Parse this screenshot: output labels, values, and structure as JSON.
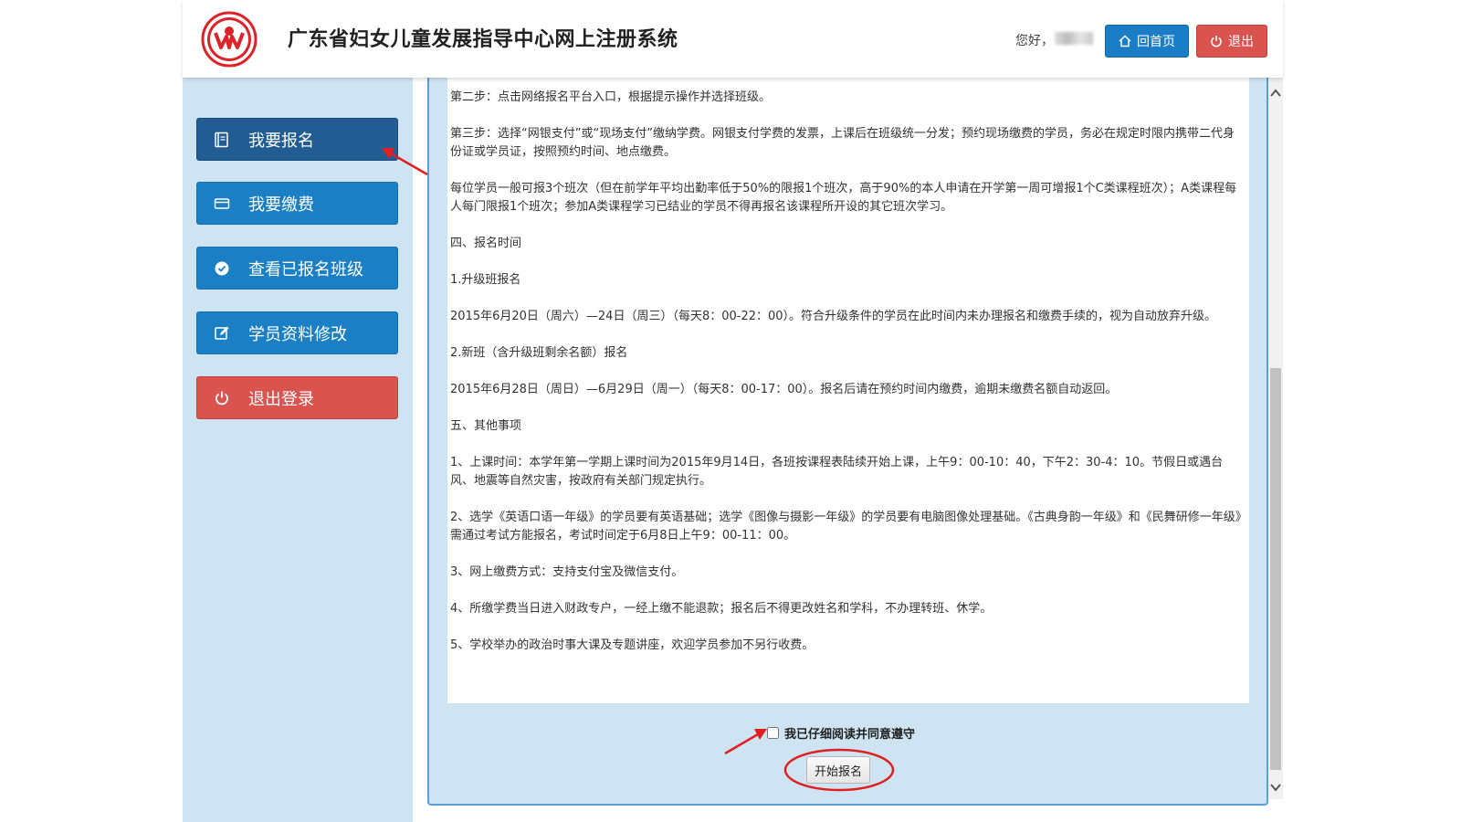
{
  "header": {
    "title": "广东省妇女儿童发展指导中心网上注册系统",
    "greeting": "您好，",
    "home_label": "回首页",
    "logout_label": "退出",
    "logo_text": "M"
  },
  "sidebar": {
    "items": [
      {
        "label": "我要报名",
        "icon": "book-icon"
      },
      {
        "label": "我要缴费",
        "icon": "card-icon"
      },
      {
        "label": "查看已报名班级",
        "icon": "check-circle-icon"
      },
      {
        "label": "学员资料修改",
        "icon": "edit-icon"
      },
      {
        "label": "退出登录",
        "icon": "power-icon"
      }
    ]
  },
  "content": {
    "paragraphs": [
      "第二步：点击网络报名平台入口，根据提示操作并选择班级。",
      "第三步：选择“网银支付”或“现场支付”缴纳学费。网银支付学费的发票，上课后在班级统一分发；预约现场缴费的学员，务必在规定时限内携带二代身份证或学员证，按照预约时间、地点缴费。",
      "每位学员一般可报3个班次（但在前学年平均出勤率低于50%的限报1个班次，高于90%的本人申请在开学第一周可增报1个C类课程班次）；A类课程每人每门限报1个班次；参加A类课程学习已结业的学员不得再报名该课程所开设的其它班次学习。",
      "四、报名时间",
      "1.升级班报名",
      "2015年6月20日（周六）—24日（周三）（每天8：00-22：00）。符合升级条件的学员在此时间内未办理报名和缴费手续的，视为自动放弃升级。",
      "2.新班（含升级班剩余名额）报名",
      "2015年6月28日（周日）—6月29日（周一）（每天8：00-17：00）。报名后请在预约时间内缴费，逾期未缴费名额自动返回。",
      "五、其他事项",
      "1、上课时间：本学年第一学期上课时间为2015年9月14日，各班按课程表陆续开始上课，上午9：00-10：40，下午2：30-4：10。节假日或遇台风、地震等自然灾害，按政府有关部门规定执行。",
      "2、选学《英语口语一年级》的学员要有英语基础；选学《图像与摄影一年级》的学员要有电脑图像处理基础。《古典身韵一年级》和《民舞研修一年级》需通过考试方能报名，考试时间定于6月8日上午9：00-11：00。",
      "3、网上缴费方式：支持支付宝及微信支付。",
      "4、所缴学费当日进入财政专户，一经上缴不能退款；报名后不得更改姓名和学科，不办理转班、休学。",
      "5、学校举办的政治时事大课及专题讲座，欢迎学员参加不另行收费。"
    ]
  },
  "agree_label": "我已仔细阅读并同意遵守",
  "start_label": "开始报名",
  "colors": {
    "primary": "#1b7fc6",
    "active": "#215c92",
    "danger": "#d9534f",
    "panel": "#cfe4f2",
    "annotation": "#e02020"
  }
}
